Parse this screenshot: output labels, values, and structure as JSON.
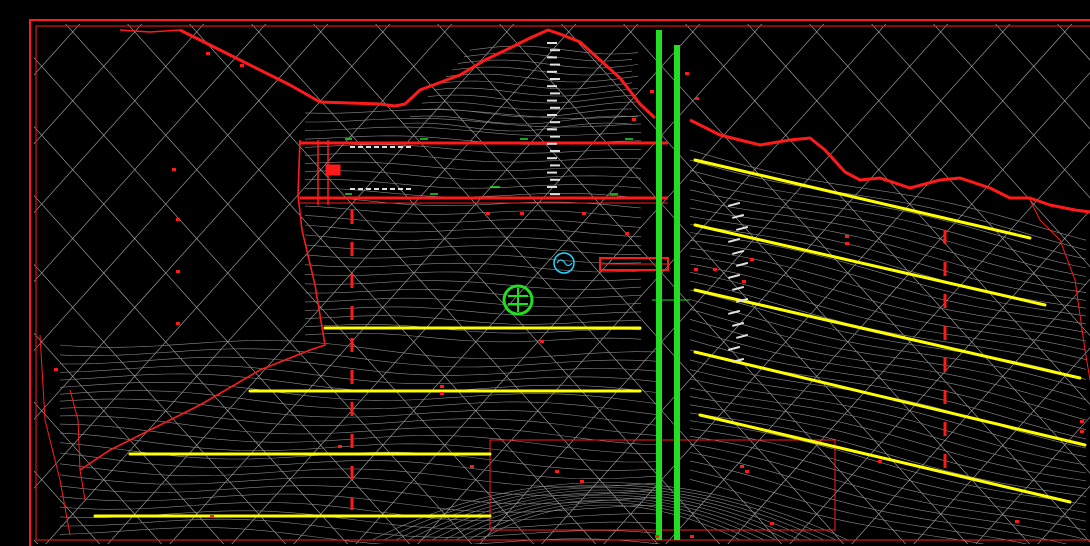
{
  "drawing": {
    "background": "#000000",
    "colors": {
      "frame": "#ff1a1a",
      "grid": "#cfcfcf",
      "contour": "#8a8a8a",
      "section": "#ffff00",
      "road": "#22dd22",
      "symbol_cyan": "#22d7ff"
    },
    "symbols": [
      {
        "name": "green-circle-symbol",
        "type": "circle-glyph"
      },
      {
        "name": "cyan-circle-symbol",
        "type": "circle-glyph"
      }
    ],
    "layers": [
      "frame",
      "grid",
      "contours",
      "boundary",
      "sections",
      "road",
      "annotations"
    ]
  }
}
